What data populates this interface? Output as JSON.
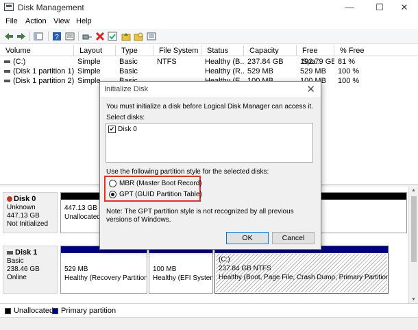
{
  "window": {
    "title": "Disk Management",
    "minimize": "—",
    "maximize": "☐",
    "close": "✕"
  },
  "menu": [
    "File",
    "Action",
    "View",
    "Help"
  ],
  "toolbar_icons": [
    "back-icon",
    "forward-icon",
    "console-tree-icon",
    "help-icon",
    "properties-icon",
    "connect-icon",
    "delete-icon",
    "check-icon",
    "folder-up-icon",
    "open-folder-icon",
    "list-icon"
  ],
  "volume_table": {
    "headers": [
      "Volume",
      "Layout",
      "Type",
      "File System",
      "Status",
      "Capacity",
      "Free Spa...",
      "% Free"
    ],
    "rows": [
      [
        "(C:)",
        "Simple",
        "Basic",
        "NTFS",
        "Healthy (B...",
        "237.84 GB",
        "192.79 GB",
        "81 %"
      ],
      [
        "(Disk 1 partition 1)",
        "Simple",
        "Basic",
        "",
        "Healthy (R...",
        "529 MB",
        "529 MB",
        "100 %"
      ],
      [
        "(Disk 1 partition 2)",
        "Simple",
        "Basic",
        "",
        "Healthy (E...",
        "100 MB",
        "100 MB",
        "100 %"
      ]
    ]
  },
  "disks": [
    {
      "name": "Disk 0",
      "type": "Unknown",
      "size": "447.13 GB",
      "status": "Not Initialized",
      "partitions": [
        {
          "size": "447.13 GB",
          "desc": "Unallocated"
        }
      ]
    },
    {
      "name": "Disk 1",
      "type": "Basic",
      "size": "238.46 GB",
      "status": "Online",
      "partitions": [
        {
          "label": "",
          "size": "529 MB",
          "desc": "Healthy (Recovery Partition)"
        },
        {
          "label": "",
          "size": "100 MB",
          "desc": "Healthy (EFI System Partition)"
        },
        {
          "label": "(C:)",
          "size": "237.84 GB NTFS",
          "desc": "Healthy (Boot, Page File, Crash Dump, Primary Partition)"
        }
      ]
    }
  ],
  "legend": [
    "Unallocated",
    "Primary partition"
  ],
  "colors": {
    "unallocated": "#000000",
    "primary": "#00007f",
    "highlight": "#d9342b"
  },
  "dialog": {
    "title": "Initialize Disk",
    "intro": "You must initialize a disk before Logical Disk Manager can access it.",
    "select_label": "Select disks:",
    "disk_item": "Disk 0",
    "style_label": "Use the following partition style for the selected disks:",
    "mbr_label": "MBR (Master Boot Record)",
    "gpt_label": "GPT (GUID Partition Table)",
    "note": "Note: The GPT partition style is not recognized by all previous versions of Windows.",
    "ok": "OK",
    "cancel": "Cancel"
  }
}
